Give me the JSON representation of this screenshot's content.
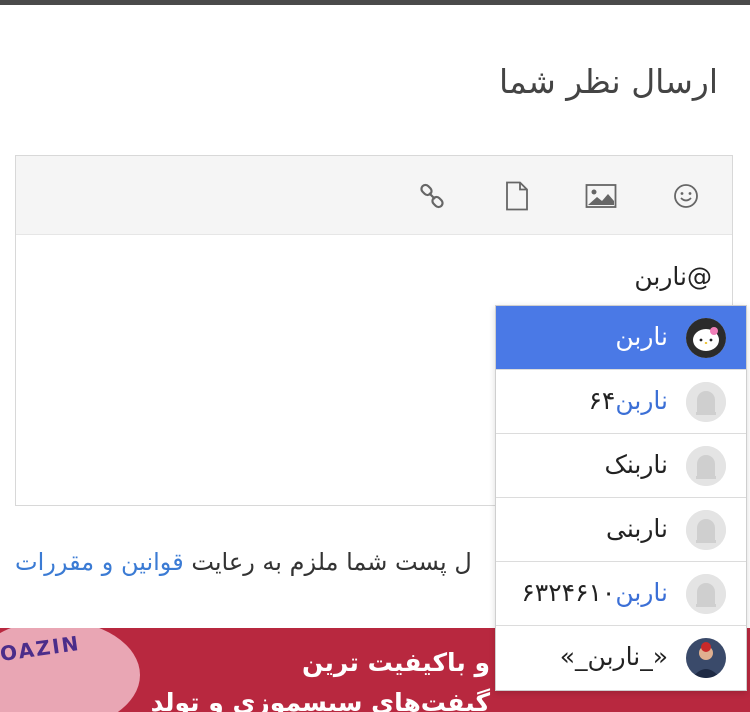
{
  "page": {
    "title": "ارسال نظر شما"
  },
  "editor": {
    "content_text": "@ناربن",
    "toolbar": {
      "emoji": "emoji-icon",
      "image": "image-icon",
      "file": "file-icon",
      "link": "link-icon"
    }
  },
  "mentions": {
    "items": [
      {
        "prefix": "",
        "highlight": "ناربن",
        "suffix": "",
        "avatar": "hello-kitty",
        "active": true
      },
      {
        "prefix": "",
        "highlight": "ناربن",
        "suffix": "۶۴",
        "avatar": "default"
      },
      {
        "prefix": "",
        "highlight": "",
        "suffix": "ناربنک",
        "avatar": "default"
      },
      {
        "prefix": "",
        "highlight": "",
        "suffix": "ناربنی",
        "avatar": "default"
      },
      {
        "prefix": "",
        "highlight": "ناربن",
        "suffix": "۶۳۲۴۶۱۰",
        "avatar": "default"
      },
      {
        "prefix": "",
        "highlight": "",
        "suffix": "«_ناربن_»",
        "avatar": "photo"
      }
    ]
  },
  "notice": {
    "text": "ل پست شما ملزم به رعایت",
    "link": "قوانین و مقررات"
  },
  "banner": {
    "logo_text": "MOAZIN",
    "line1": "و باکیفیت ترین",
    "line2": "گیفت‌های سیسموزی و تولد"
  },
  "colors": {
    "accent": "#4a79e6",
    "link": "#3b7bd4",
    "banner": "#b8283f"
  }
}
